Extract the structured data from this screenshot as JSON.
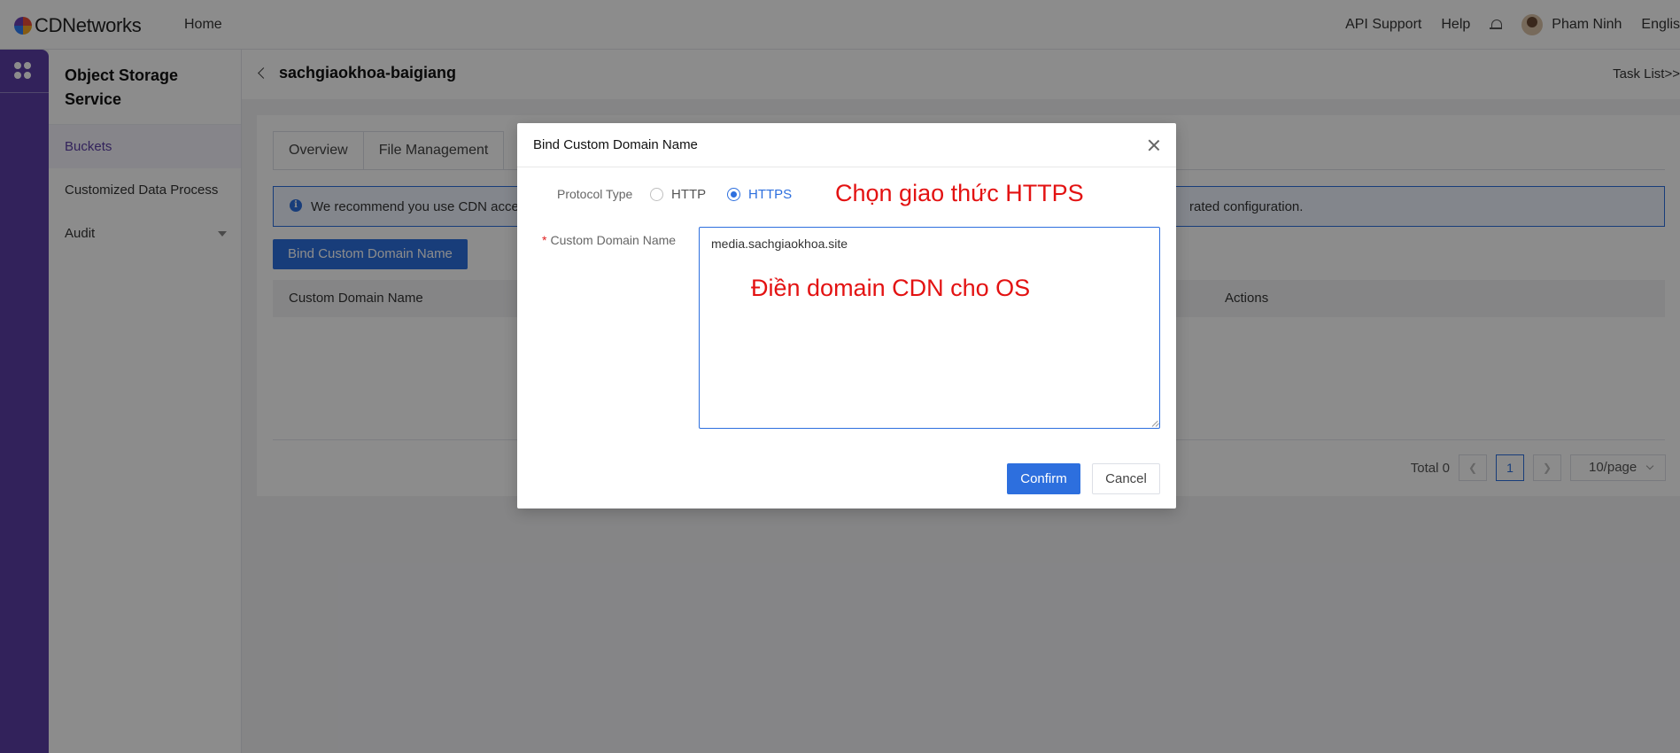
{
  "topbar": {
    "brand": "CDNetworks",
    "home": "Home",
    "api_support": "API Support",
    "help": "Help",
    "user_name": "Pham Ninh",
    "language": "Englis"
  },
  "sidebar": {
    "title": "Object Storage Service",
    "items": [
      {
        "label": "Buckets",
        "active": true
      },
      {
        "label": "Customized Data Process"
      },
      {
        "label": "Audit"
      }
    ]
  },
  "header": {
    "title": "sachgiaokhoa-baigiang",
    "task_list": "Task List>>"
  },
  "main": {
    "tabs": [
      {
        "label": "Overview"
      },
      {
        "label": "File Management"
      }
    ],
    "notice": "We recommend you use CDN accele",
    "notice_tail": "rated configuration.",
    "bind_button": "Bind Custom Domain Name",
    "table": {
      "columns": [
        "Custom Domain Name",
        "Actions"
      ]
    },
    "pagination": {
      "total": "Total 0",
      "current_page": "1",
      "page_size": "10/page"
    }
  },
  "modal": {
    "title": "Bind Custom Domain Name",
    "protocol_label": "Protocol Type",
    "protocol_options": [
      "HTTP",
      "HTTPS"
    ],
    "protocol_selected": "HTTPS",
    "domain_label": "Custom Domain Name",
    "domain_value": "media.sachgiaokhoa.site",
    "confirm": "Confirm",
    "cancel": "Cancel"
  },
  "annotations": {
    "protocol_note": "Chọn giao thức HTTPS",
    "domain_note": "Điền domain CDN cho OS"
  },
  "colors": {
    "accent": "#2d6fde",
    "brand_purple": "#5b3ea6",
    "annotation_red": "#e31212"
  }
}
